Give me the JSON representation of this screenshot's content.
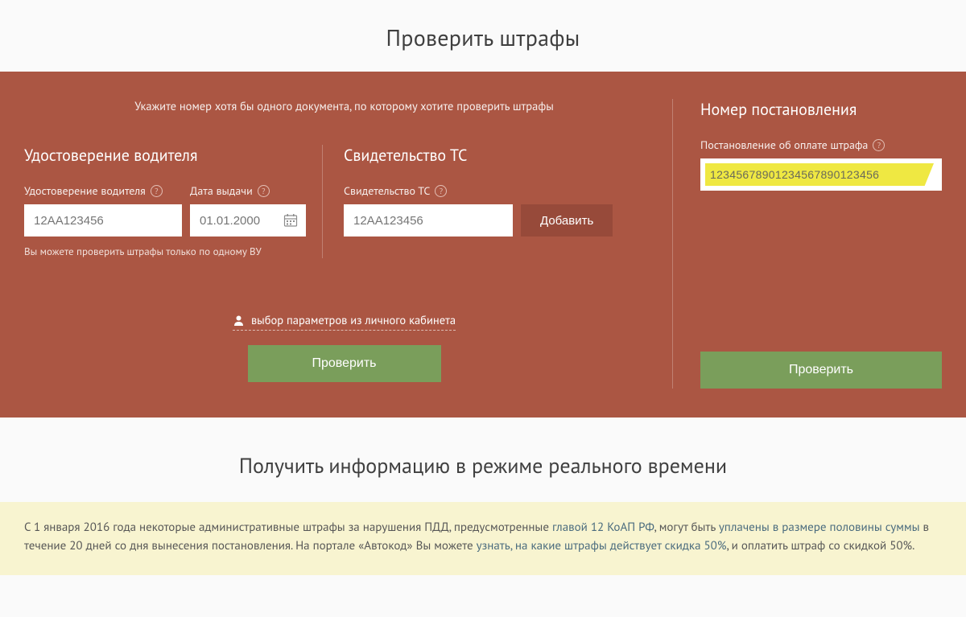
{
  "header": {
    "title": "Проверить штрафы"
  },
  "panel": {
    "instruction": "Укажите номер хотя бы одного документа, по которому хотите проверить штрафы",
    "driver": {
      "title": "Удостоверение водителя",
      "num_label": "Удостоверение водителя",
      "num_placeholder": "12АА123456",
      "date_label": "Дата выдачи",
      "date_placeholder": "01.01.2000",
      "helper": "Вы можете проверить штрафы только по одному ВУ"
    },
    "cert": {
      "title": "Свидетельство ТС",
      "num_label": "Свидетельство ТС",
      "num_placeholder": "12АА123456",
      "add_label": "Добавить"
    },
    "decree": {
      "title": "Номер постановления",
      "label": "Постановление об оплате штрафа",
      "value": "12345678901234567890123456"
    },
    "profile_link": "выбор параметров из личного кабинета",
    "check_label": "Проверить"
  },
  "section2": {
    "title": "Получить информацию в режиме реального времени"
  },
  "banner": {
    "t1": "С 1 января 2016 года некоторые административные штрафы за нарушения ПДД, предусмотренные ",
    "l1": "главой 12 КоАП РФ",
    "t2": ", могут быть ",
    "l2": "уплачены в размере половины суммы",
    "t3": " в течение 20 дней со дня вынесения постановления. На портале «Автокод» Вы можете ",
    "l3": "узнать, на какие штрафы действует скидка 50%",
    "t4": ", и оплатить штраф со скидкой 50%."
  }
}
